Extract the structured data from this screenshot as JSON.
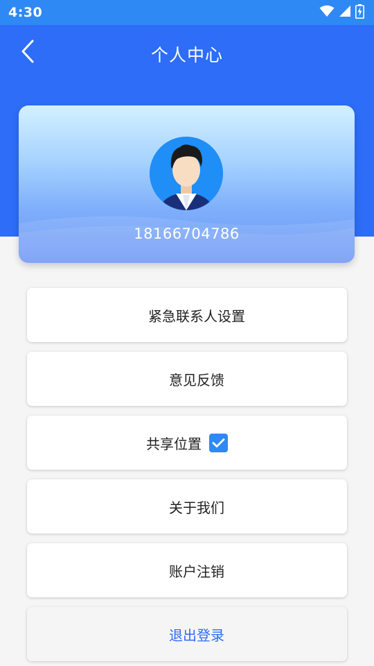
{
  "status_bar": {
    "time": "4:30",
    "icons": [
      "wifi-icon",
      "signal-icon",
      "battery-icon"
    ]
  },
  "header": {
    "title": "个人中心",
    "back_icon": "chevron-left-icon"
  },
  "profile": {
    "phone": "18166704786",
    "avatar_icon": "user-avatar"
  },
  "menu": {
    "emergency_contact": "紧急联系人设置",
    "feedback": "意见反馈",
    "share_location": "共享位置",
    "share_location_checked": true,
    "about_us": "关于我们",
    "account_cancel": "账户注销",
    "logout": "退出登录"
  },
  "colors": {
    "primary": "#2d6df7",
    "status_bar": "#2f89f5",
    "checkbox": "#2f89f5",
    "background": "#f5f5f5"
  }
}
